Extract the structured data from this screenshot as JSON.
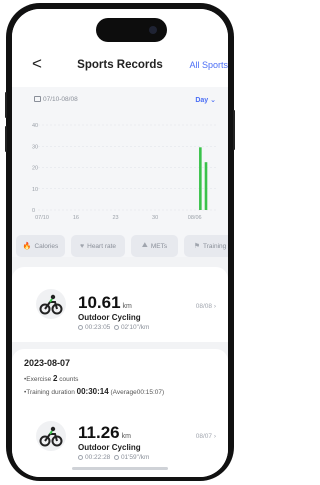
{
  "header": {
    "back_label": "<",
    "title": "Sports Records",
    "all_sports_label": "All Sports"
  },
  "chart_card": {
    "date_range": "07/10-08/08",
    "period_label": "Day",
    "period_chevron": "⌄"
  },
  "chart_data": {
    "type": "bar",
    "y_ticks": [
      "40",
      "30",
      "20",
      "10",
      "0"
    ],
    "x_ticks": [
      "07/10",
      "16",
      "23",
      "30",
      "08/06"
    ],
    "ylim": [
      0,
      40
    ],
    "bar_color": "#3ac24a",
    "x": [
      "08/07",
      "08/08"
    ],
    "values": [
      29.5,
      22.5
    ]
  },
  "metrics": [
    {
      "icon": "flame-icon",
      "label": "Calories"
    },
    {
      "icon": "heart-icon",
      "label": "Heart rate"
    },
    {
      "icon": "mountain-icon",
      "label": "METs"
    },
    {
      "icon": "training-icon",
      "label": "Training"
    }
  ],
  "records": [
    {
      "distance": "10.61",
      "unit": "km",
      "date": "08/08",
      "chevron": "›",
      "sport": "Outdoor Cycling",
      "duration": "00:23:05",
      "pace": "02'10\"/km"
    }
  ],
  "day_summary": {
    "date": "2023-08-07",
    "exercise_prefix": "•Exercise ",
    "exercise_count": "2",
    "exercise_suffix": " counts",
    "training_prefix": "•Training duration ",
    "training_duration": "00:30:14",
    "training_average": "(Average00:15:07)",
    "record": {
      "distance": "11.26",
      "unit": "km",
      "date": "08/07",
      "chevron": "›",
      "sport": "Outdoor Cycling",
      "duration": "00:22:28",
      "pace": "01'59\"/km"
    }
  }
}
